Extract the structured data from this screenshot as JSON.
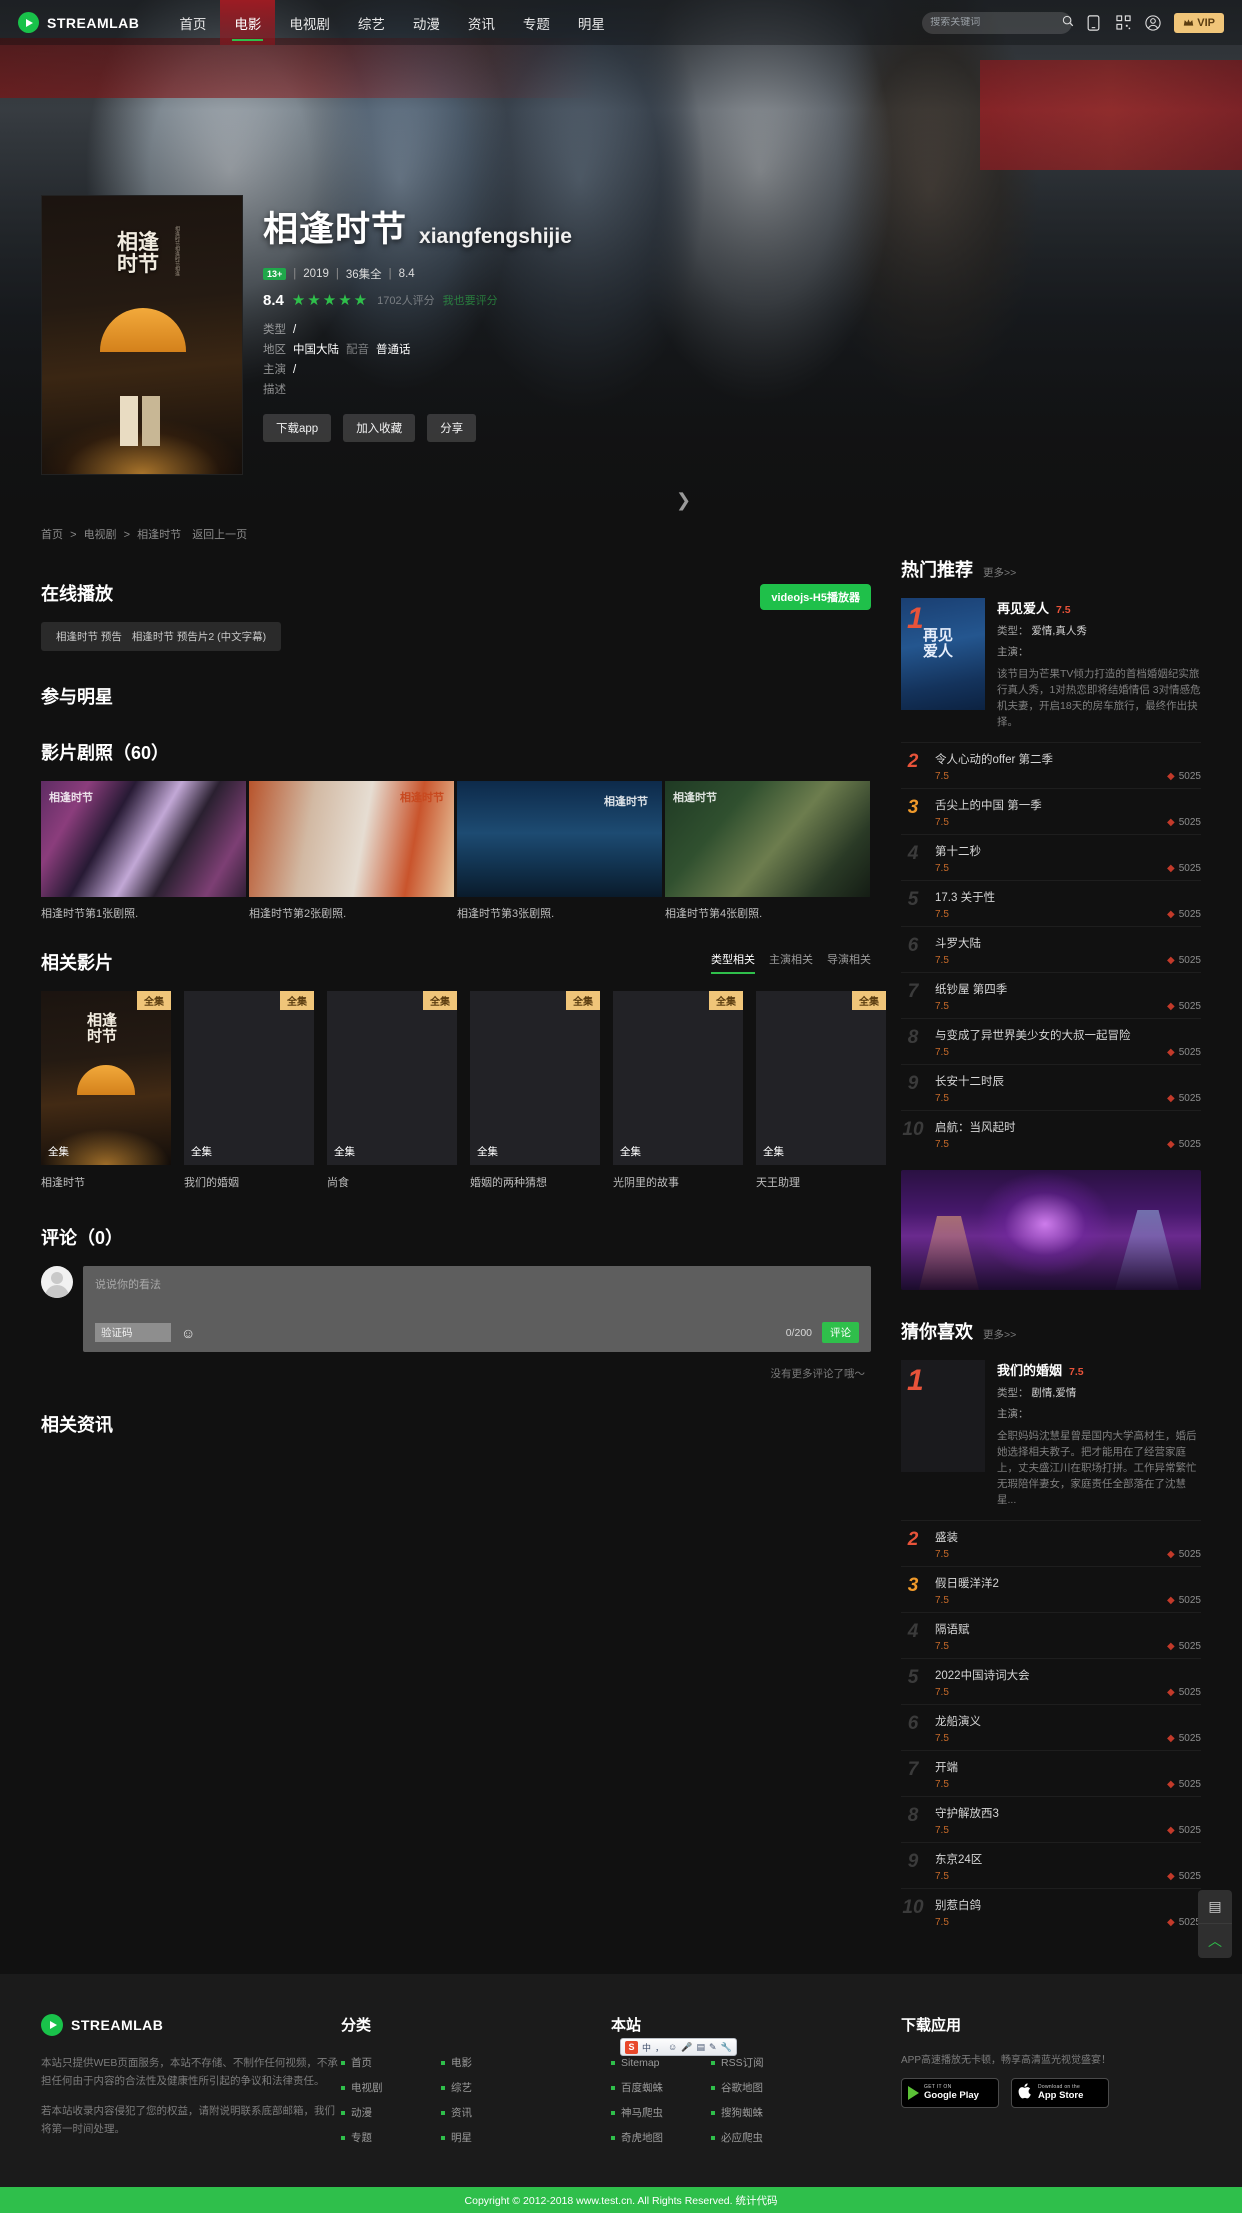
{
  "header": {
    "brand": "STREAMLAB",
    "nav": [
      {
        "label": "首页",
        "active": false
      },
      {
        "label": "电影",
        "active": true
      },
      {
        "label": "电视剧",
        "active": false
      },
      {
        "label": "综艺",
        "active": false
      },
      {
        "label": "动漫",
        "active": false
      },
      {
        "label": "资讯",
        "active": false
      },
      {
        "label": "专题",
        "active": false
      },
      {
        "label": "明星",
        "active": false
      }
    ],
    "search_placeholder": "搜索关键词",
    "icons": [
      "search-icon",
      "mobile-icon",
      "qrcode-icon",
      "user-icon"
    ],
    "vip_label": "VIP"
  },
  "hero": {
    "title": "相逢时节",
    "pinyin": "xiangfengshijie",
    "age_badge": "13+",
    "year": "2019",
    "episodes": "36集全",
    "score_inline": "8.4",
    "rating": "8.4",
    "stars": "★★★★★",
    "rating_count": "1702人评分",
    "rating_link": "我也要评分",
    "info": [
      {
        "key": "类型",
        "value": "/"
      },
      {
        "key": "地区",
        "value": "中国大陆",
        "sub_key": "配音",
        "sub_value": "普通话"
      },
      {
        "key": "主演",
        "value": "/"
      },
      {
        "key": "描述",
        "value": ""
      }
    ],
    "buttons": [
      "下载app",
      "加入收藏",
      "分享"
    ],
    "poster_title": "相逢时节",
    "poster_side": "相逢时节相逢时节相逢"
  },
  "breadcrumb": {
    "items": [
      "首页",
      "电视剧",
      "相逢时节"
    ],
    "back": "返回上一页",
    "arrow": ">"
  },
  "online_play": {
    "title": "在线播放",
    "player_badge": "videojs-H5播放器",
    "episodes": [
      "相逢时节 预告",
      "相逢时节 预告片2 (中文字幕)"
    ]
  },
  "stars_section": {
    "title": "参与明星"
  },
  "stills": {
    "title": "影片剧照（60）",
    "items": [
      {
        "caption": "相逢时节第1张剧照.",
        "watermark": "相逢时节"
      },
      {
        "caption": "相逢时节第2张剧照.",
        "watermark": "相逢时节"
      },
      {
        "caption": "相逢时节第3张剧照.",
        "watermark": "相逢时节"
      },
      {
        "caption": "相逢时节第4张剧照.",
        "watermark": "相逢时节"
      }
    ]
  },
  "related": {
    "title": "相关影片",
    "tabs": [
      {
        "label": "类型相关",
        "active": true
      },
      {
        "label": "主演相关",
        "active": false
      },
      {
        "label": "导演相关",
        "active": false
      }
    ],
    "films": [
      {
        "name": "相逢时节",
        "corner": "全集",
        "ep": "全集"
      },
      {
        "name": "我们的婚姻",
        "corner": "全集",
        "ep": "全集"
      },
      {
        "name": "尚食",
        "corner": "全集",
        "ep": "全集"
      },
      {
        "name": "婚姻的两种猜想",
        "corner": "全集",
        "ep": "全集"
      },
      {
        "name": "光阴里的故事",
        "corner": "全集",
        "ep": "全集"
      },
      {
        "name": "天王助理",
        "corner": "全集",
        "ep": "全集"
      }
    ]
  },
  "comments": {
    "title": "评论（0）",
    "placeholder": "说说你的看法",
    "captcha_placeholder": "验证码",
    "counter": "0/200",
    "submit": "评论",
    "empty": "没有更多评论了哦～"
  },
  "news": {
    "title": "相关资讯"
  },
  "sidebar_hot": {
    "title": "热门推荐",
    "more": "更多>>",
    "featured": {
      "rank": "1",
      "name": "再见爱人",
      "score": "7.5",
      "type_key": "类型：",
      "type_value": "爱情,真人秀",
      "cast_key": "主演：",
      "cast_value": "",
      "desc": "该节目为芒果TV倾力打造的首档婚姻纪实旅行真人秀，1对热恋即将结婚情侣 3对情感危机夫妻，开启18天的房车旅行，最终作出抉择。",
      "poster_title": "再见爱人"
    },
    "list": [
      {
        "rank": "2",
        "name": "令人心动的offer 第二季",
        "score": "7.5",
        "hot": "5025"
      },
      {
        "rank": "3",
        "name": "舌尖上的中国 第一季",
        "score": "7.5",
        "hot": "5025"
      },
      {
        "rank": "4",
        "name": "第十二秒",
        "score": "7.5",
        "hot": "5025"
      },
      {
        "rank": "5",
        "name": "17.3 关于性",
        "score": "7.5",
        "hot": "5025"
      },
      {
        "rank": "6",
        "name": "斗罗大陆",
        "score": "7.5",
        "hot": "5025"
      },
      {
        "rank": "7",
        "name": "纸钞屋 第四季",
        "score": "7.5",
        "hot": "5025"
      },
      {
        "rank": "8",
        "name": "与变成了异世界美少女的大叔一起冒险",
        "score": "7.5",
        "hot": "5025"
      },
      {
        "rank": "9",
        "name": "长安十二时辰",
        "score": "7.5",
        "hot": "5025"
      },
      {
        "rank": "10",
        "name": "启航：当风起时",
        "score": "7.5",
        "hot": "5025"
      }
    ]
  },
  "sidebar_like": {
    "title": "猜你喜欢",
    "more": "更多>>",
    "featured": {
      "rank": "1",
      "name": "我们的婚姻",
      "score": "7.5",
      "type_key": "类型：",
      "type_value": "剧情,爱情",
      "cast_key": "主演：",
      "cast_value": "",
      "desc": "全职妈妈沈慧星曾是国内大学高材生，婚后她选择相夫教子。把才能用在了经营家庭上，丈夫盛江川在职场打拼。工作异常繁忙无瑕陪伴妻女，家庭责任全部落在了沈慧星..."
    },
    "list": [
      {
        "rank": "2",
        "name": "盛装",
        "score": "7.5",
        "hot": "5025"
      },
      {
        "rank": "3",
        "name": "假日暖洋洋2",
        "score": "7.5",
        "hot": "5025"
      },
      {
        "rank": "4",
        "name": "隔语赋",
        "score": "7.5",
        "hot": "5025"
      },
      {
        "rank": "5",
        "name": "2022中国诗词大会",
        "score": "7.5",
        "hot": "5025"
      },
      {
        "rank": "6",
        "name": "龙船演义",
        "score": "7.5",
        "hot": "5025"
      },
      {
        "rank": "7",
        "name": "开端",
        "score": "7.5",
        "hot": "5025"
      },
      {
        "rank": "8",
        "name": "守护解放西3",
        "score": "7.5",
        "hot": "5025"
      },
      {
        "rank": "9",
        "name": "东京24区",
        "score": "7.5",
        "hot": "5025"
      },
      {
        "rank": "10",
        "name": "别惹白鸽",
        "score": "7.5",
        "hot": "5025"
      }
    ]
  },
  "footer": {
    "brand": "STREAMLAB",
    "text1": "本站只提供WEB页面服务，本站不存储、不制作任何视频，不承担任何由于内容的合法性及健康性所引起的争议和法律责任。",
    "text2": "若本站收录内容侵犯了您的权益，请附说明联系底部邮箱，我们将第一时间处理。",
    "cat_title": "分类",
    "cat_links_a": [
      "首页",
      "电视剧",
      "动漫",
      "专题"
    ],
    "cat_links_b": [
      "电影",
      "综艺",
      "资讯",
      "明星"
    ],
    "site_title": "本站",
    "site_links_a": [
      "Sitemap",
      "百度蜘蛛",
      "神马爬虫",
      "奇虎地图"
    ],
    "site_links_b": [
      "RSS订阅",
      "谷歌地图",
      "搜狗蜘蛛",
      "必应爬虫"
    ],
    "app_title": "下载应用",
    "app_note": "APP高速播放无卡顿，畅享高清蓝光视觉盛宴！",
    "store_google": {
      "small": "GET IT ON",
      "big": "Google Play"
    },
    "store_apple": {
      "small": "Download on the",
      "big": "App Store"
    },
    "copyright": "Copyright © 2012-2018 www.test.cn. All Rights Reserved. 统计代码"
  },
  "float_widget": {
    "items": [
      "comment-icon",
      "scroll-top-icon"
    ]
  },
  "ime": {
    "label": "中",
    "items": [
      "、",
      "☺",
      "⌨",
      "🎤",
      "📋",
      "✎",
      "🔧"
    ]
  }
}
